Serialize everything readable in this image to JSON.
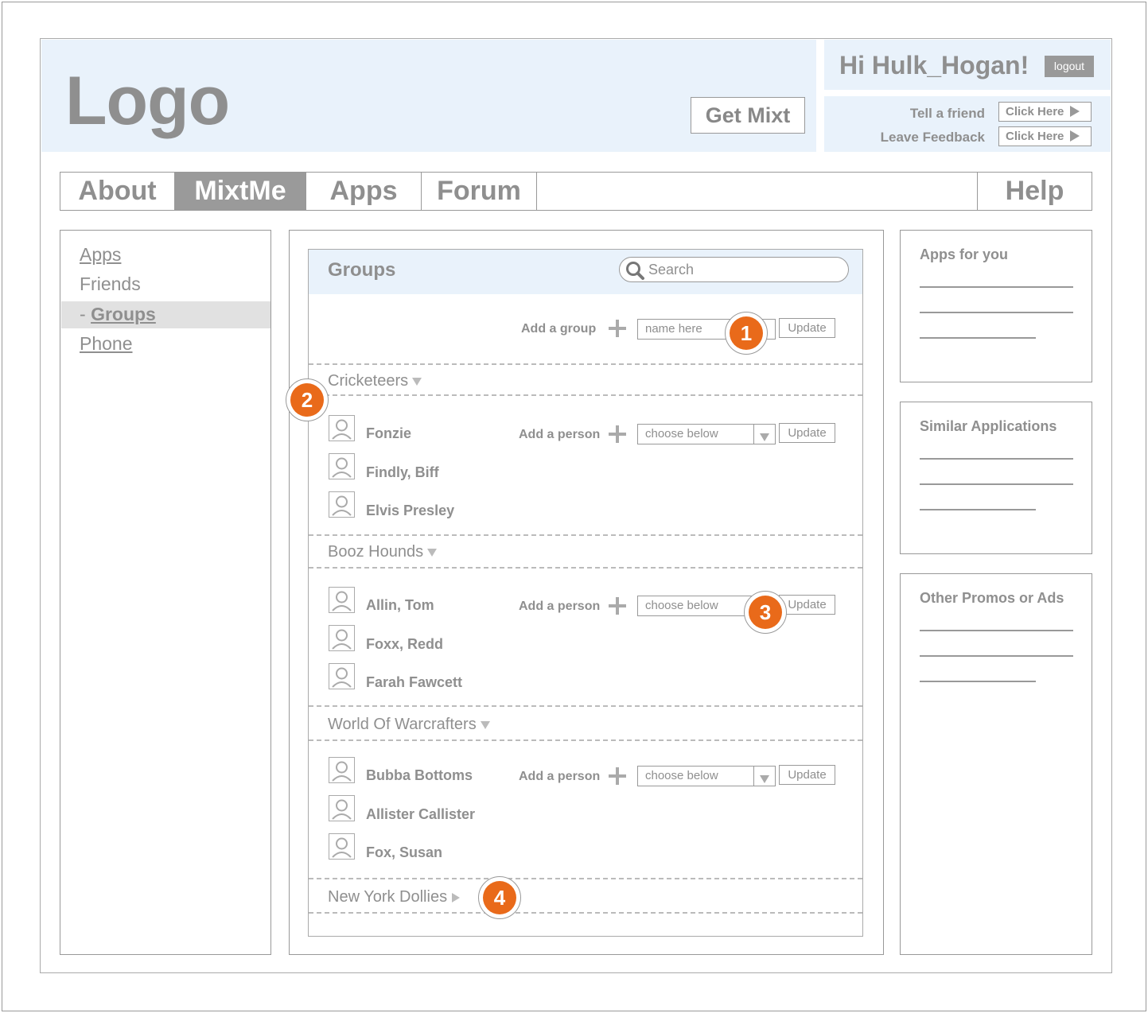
{
  "header": {
    "logo": "Logo",
    "get_mixt": "Get Mixt",
    "greeting": "Hi Hulk_Hogan!",
    "logout": "logout",
    "links": [
      {
        "label": "Tell a friend",
        "button": "Click Here"
      },
      {
        "label": "Leave Feedback",
        "button": "Click Here"
      }
    ]
  },
  "nav": {
    "tabs": [
      "About",
      "MixtMe",
      "Apps",
      "Forum"
    ],
    "active": "MixtMe",
    "help": "Help"
  },
  "sidebar": {
    "items": [
      {
        "label": "Apps"
      },
      {
        "label": "Friends"
      },
      {
        "prefix": "- ",
        "label": "Groups"
      },
      {
        "label": "Phone"
      }
    ]
  },
  "groups": {
    "title": "Groups",
    "search_placeholder": "Search",
    "add_group_label": "Add a group",
    "add_group_placeholder": "name here",
    "update": "Update",
    "add_person_label": "Add a person",
    "choose_placeholder": "choose below",
    "list": [
      {
        "name": "Cricketeers",
        "members": [
          "Fonzie",
          "Findly, Biff",
          "Elvis Presley"
        ]
      },
      {
        "name": "Booz Hounds",
        "members": [
          "Allin, Tom",
          "Foxx, Redd",
          "Farah Fawcett"
        ]
      },
      {
        "name": "World Of Warcrafters",
        "members": [
          "Bubba Bottoms",
          "Allister Callister",
          "Fox, Susan"
        ]
      },
      {
        "name": "New York Dollies",
        "members": []
      }
    ]
  },
  "annotations": [
    "1",
    "2",
    "3",
    "4"
  ],
  "right": {
    "boxes": [
      "Apps for you",
      "Similar Applications",
      "Other Promos or Ads"
    ]
  },
  "colors": {
    "accent_orange": "#e96a1a",
    "header_bg": "#e9f2fb",
    "active_tab": "#9a9a9a"
  }
}
